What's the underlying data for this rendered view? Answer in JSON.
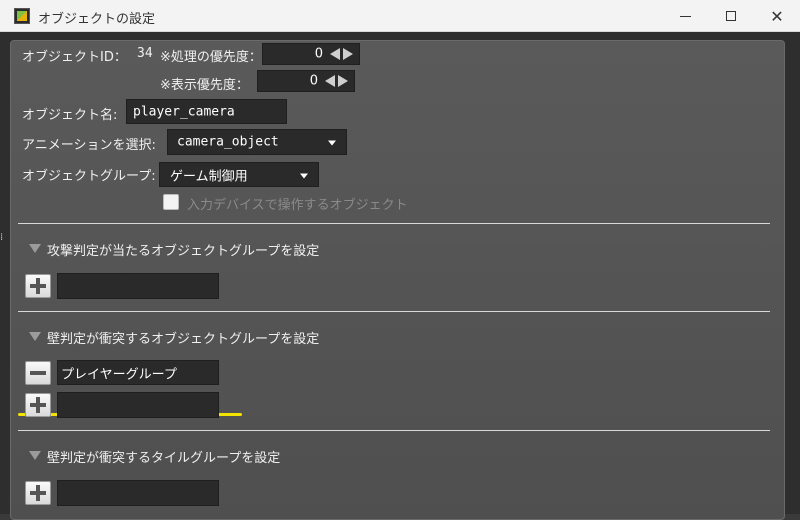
{
  "window": {
    "title": "オブジェクトの設定"
  },
  "object": {
    "id_label": "オブジェクトID：",
    "id_value": "34",
    "priority_label": "※処理の優先度：",
    "priority_value": "0",
    "display_priority_label": "※表示優先度：",
    "display_priority_value": "0",
    "name_label": "オブジェクト名:",
    "name_value": "player_camera",
    "animation_label": "アニメーションを選択:",
    "animation_value": "camera_object",
    "group_label": "オブジェクトグループ:",
    "group_value": "ゲーム制御用",
    "input_device_label": "入力デバイスで操作するオブジェクト"
  },
  "sections": [
    {
      "title": "攻撃判定が当たるオブジェクトグループを設定",
      "items": []
    },
    {
      "title": "壁判定が衝突するオブジェクトグループを設定",
      "items": [
        "プレイヤーグループ"
      ]
    },
    {
      "title": "壁判定が衝突するタイルグループを設定",
      "items": []
    }
  ],
  "colors": {
    "highlight": "#f2e300",
    "panel": "#555555",
    "field": "#2a2a2a"
  }
}
